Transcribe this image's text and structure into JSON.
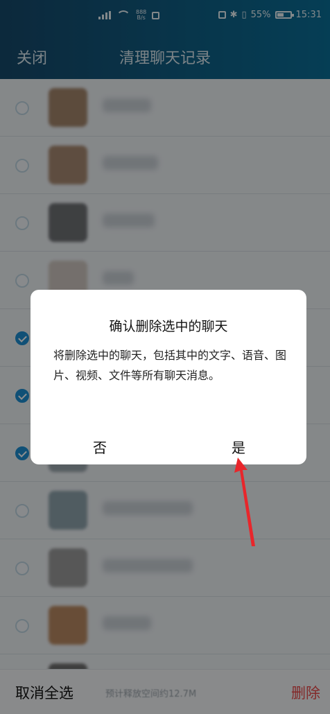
{
  "status_bar": {
    "speed_top": "888",
    "speed_bottom": "B/s",
    "battery": "55%",
    "time": "15:31"
  },
  "header": {
    "close_label": "关闭",
    "title": "清理聊天记录"
  },
  "list": {
    "items": [
      {
        "checked": false,
        "avatar_color": "#a4866c"
      },
      {
        "checked": false,
        "avatar_color": "#a88a72"
      },
      {
        "checked": false,
        "avatar_color": "#6f7275"
      },
      {
        "checked": false,
        "avatar_color": "#cfc7c0"
      },
      {
        "checked": true,
        "avatar_color": "#b5a494"
      },
      {
        "checked": true,
        "avatar_color": "#9e9c9a"
      },
      {
        "checked": true,
        "avatar_color": "#9aa6ad"
      },
      {
        "checked": false,
        "avatar_color": "#8fa4ad"
      },
      {
        "checked": false,
        "avatar_color": "#9b9c9c"
      },
      {
        "checked": false,
        "avatar_color": "#b98a62"
      },
      {
        "checked": false,
        "avatar_color": "#6f6f6f"
      }
    ]
  },
  "bottom_bar": {
    "cancel_all": "取消全选",
    "summary": "预计释放空间约12.7M",
    "delete": "删除"
  },
  "dialog": {
    "title": "确认删除选中的聊天",
    "message": "将删除选中的聊天，包括其中的文字、语音、图片、视频、文件等所有聊天消息。",
    "no_label": "否",
    "yes_label": "是"
  },
  "colors": {
    "header": "#0f5f85",
    "accent": "#1e8fd2",
    "delete": "#ea4a4a",
    "arrow": "#e8262b"
  }
}
